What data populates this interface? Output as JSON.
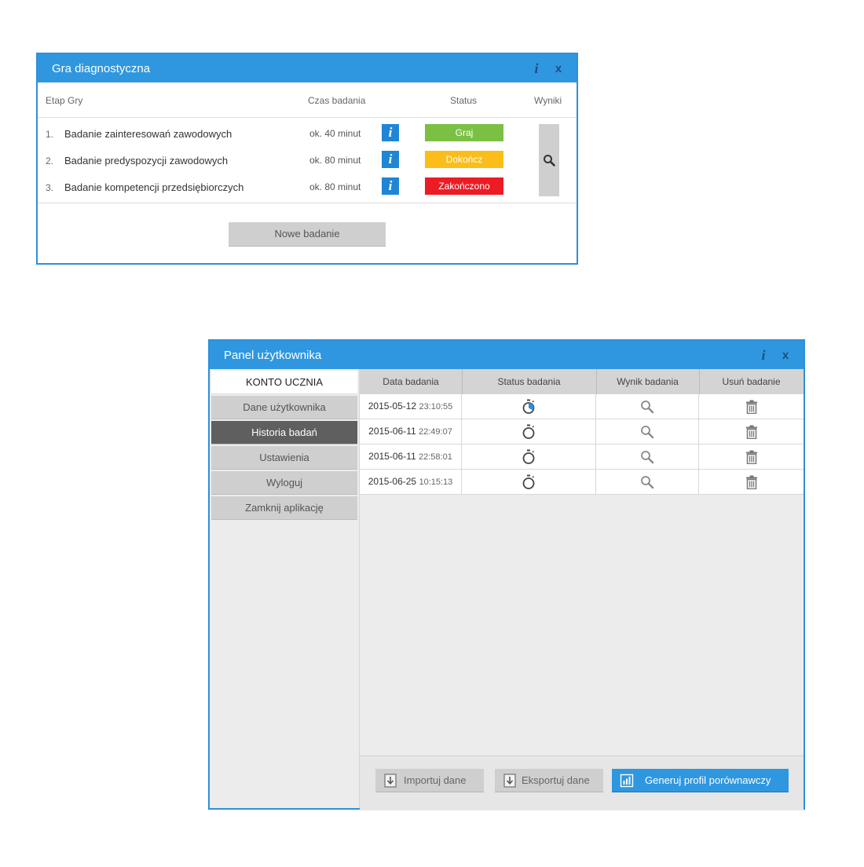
{
  "game_window": {
    "title": "Gra diagnostyczna",
    "info_icon": "info-icon",
    "close_label": "x",
    "columns": {
      "stage": "Etap Gry",
      "time": "Czas badania",
      "status": "Status",
      "results": "Wyniki"
    },
    "rows": [
      {
        "num": "1.",
        "name": "Badanie zainteresowań zawodowych",
        "time": "ok. 40 minut",
        "status": "Graj",
        "status_color": "#7bc043"
      },
      {
        "num": "2.",
        "name": "Badanie predyspozycji zawodowych",
        "time": "ok. 80 minut",
        "status": "Dokończ",
        "status_color": "#fbbd19"
      },
      {
        "num": "3.",
        "name": "Badanie kompetencji przedsiębiorczych",
        "time": "ok. 80 minut",
        "status": "Zakończono",
        "status_color": "#ed1c24"
      }
    ],
    "info_button_label": "i",
    "new_button": "Nowe badanie"
  },
  "user_panel": {
    "title": "Panel użytkownika",
    "close_label": "x",
    "sidebar": {
      "header": "KONTO UCZNIA",
      "items": [
        "Dane użytkownika",
        "Historia badań",
        "Ustawienia",
        "Wyloguj",
        "Zamknij aplikację"
      ],
      "active": "Historia badań"
    },
    "table": {
      "headers": [
        "Data badania",
        "Status badania",
        "Wynik badania",
        "Usuń badanie"
      ],
      "rows": [
        {
          "date": "2015-05-12",
          "time": "23:10:55"
        },
        {
          "date": "2015-06-11",
          "time": "22:49:07"
        },
        {
          "date": "2015-06-11",
          "time": "22:58:01"
        },
        {
          "date": "2015-06-25",
          "time": "10:15:13"
        }
      ]
    },
    "footer": {
      "import": "Importuj dane",
      "export": "Eksportuj dane",
      "generate": "Generuj profil porównawczy"
    },
    "accent_color": "#2f97e0"
  }
}
